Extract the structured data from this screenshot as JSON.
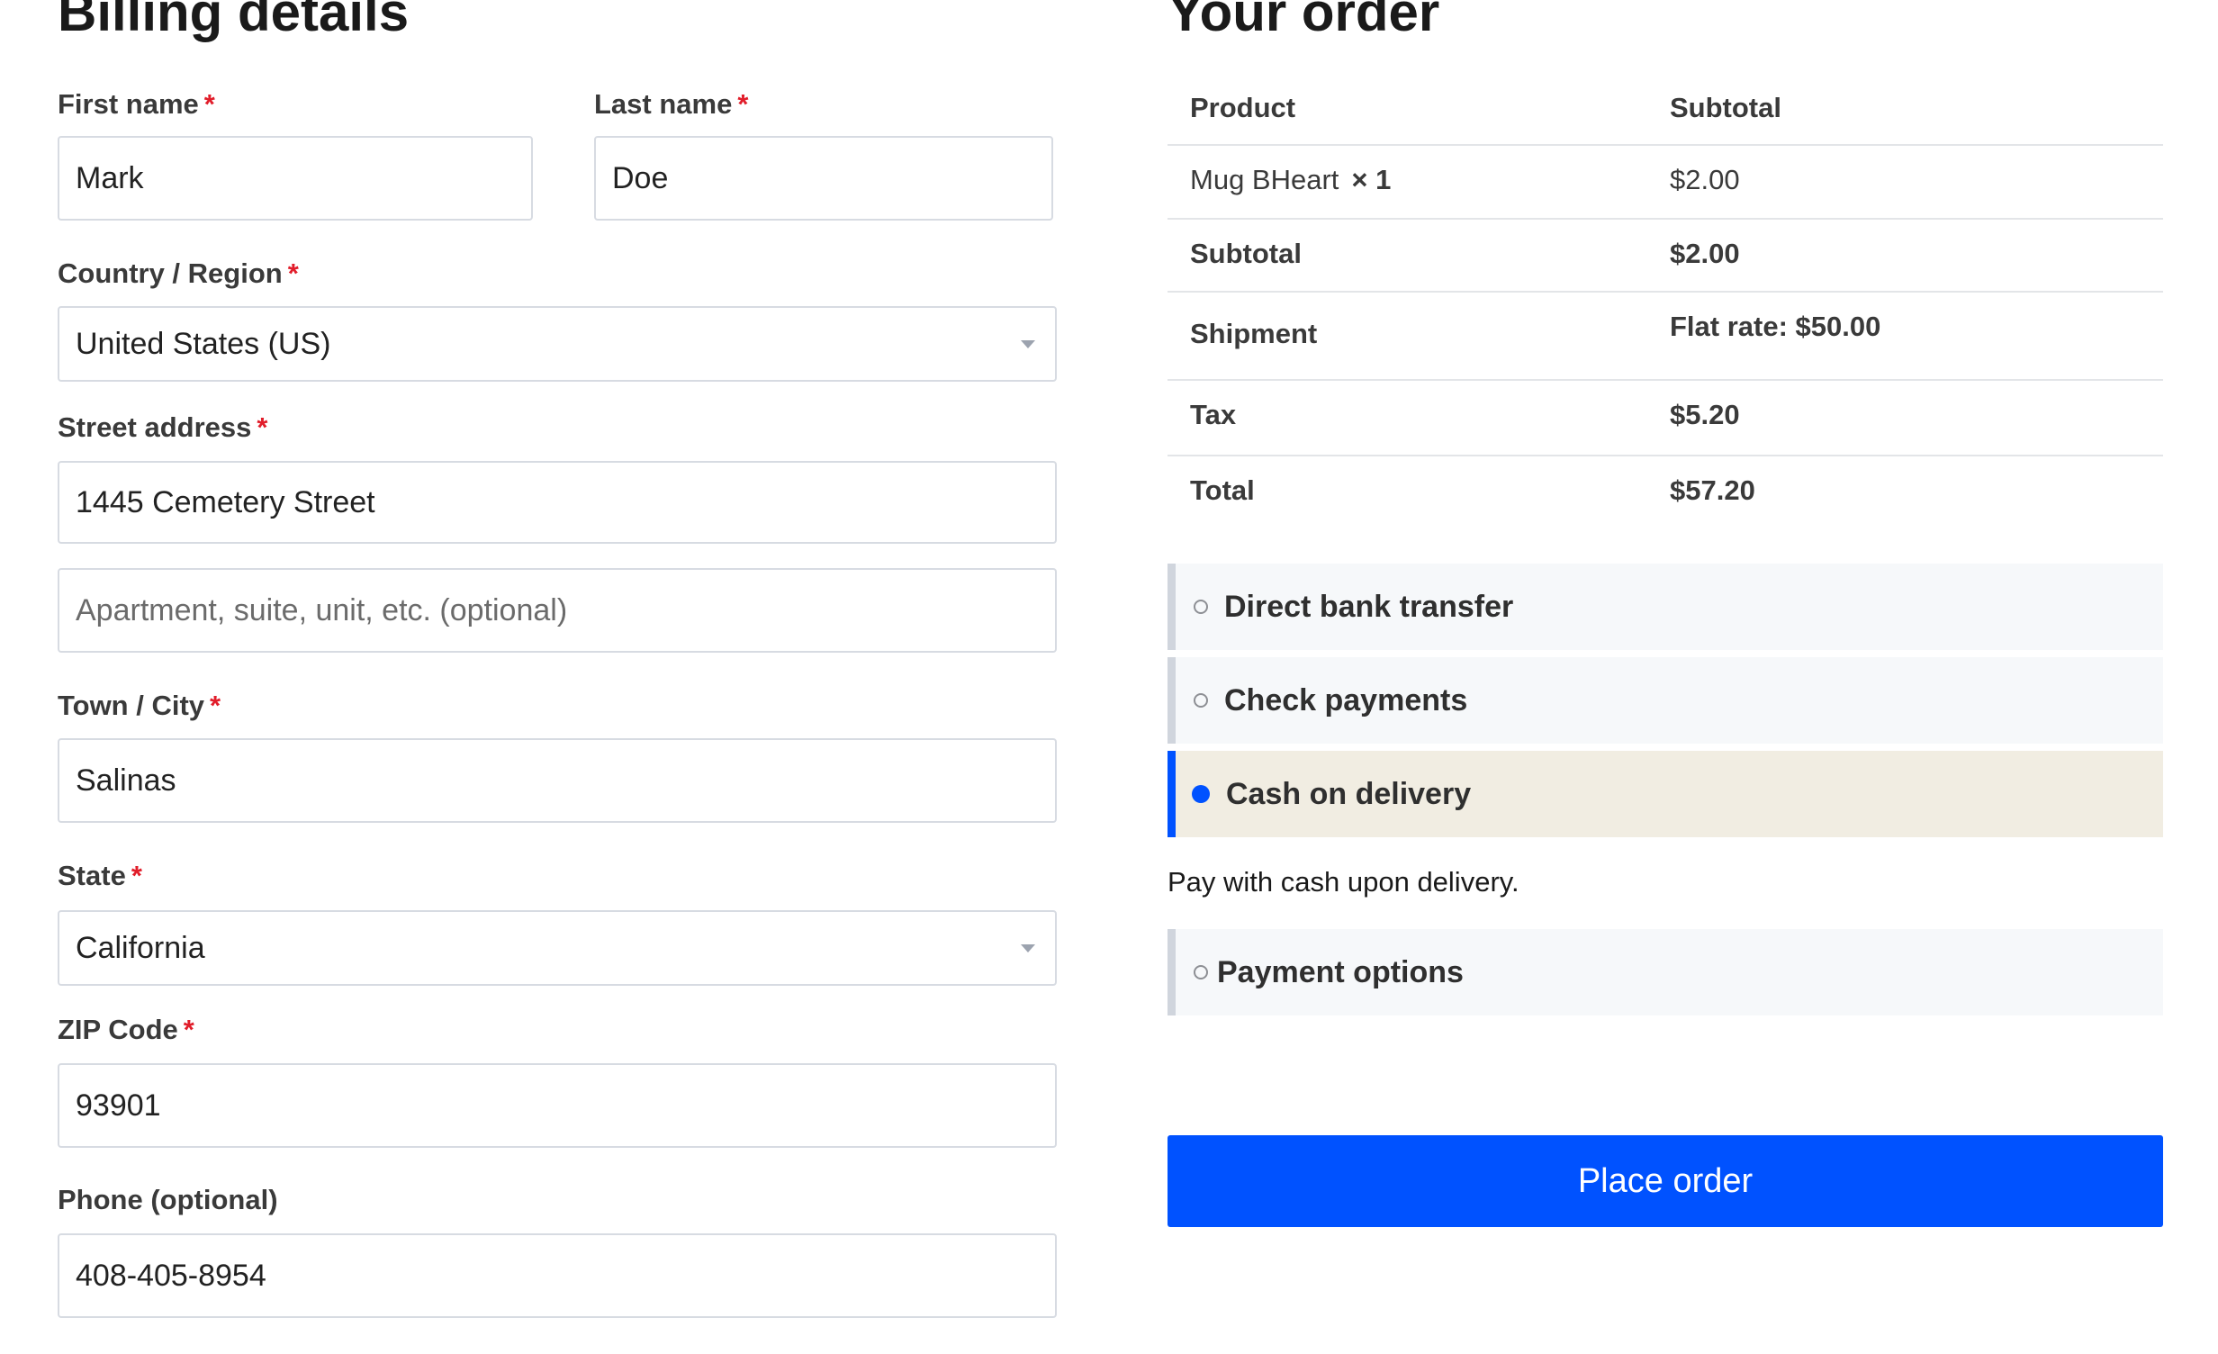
{
  "billing": {
    "title": "Billing details",
    "required_marker": "*",
    "first_name": {
      "label": "First name",
      "value": "Mark"
    },
    "last_name": {
      "label": "Last name",
      "value": "Doe"
    },
    "country": {
      "label": "Country / Region",
      "value": "United States (US)"
    },
    "street": {
      "label": "Street address",
      "value": "1445 Cemetery Street",
      "apt_placeholder": "Apartment, suite, unit, etc. (optional)"
    },
    "city": {
      "label": "Town / City",
      "value": "Salinas"
    },
    "state": {
      "label": "State",
      "value": "California"
    },
    "zip": {
      "label": "ZIP Code",
      "value": "93901"
    },
    "phone": {
      "label": "Phone (optional)",
      "value": "408-405-8954"
    }
  },
  "order": {
    "title": "Your order",
    "headers": {
      "product": "Product",
      "subtotal": "Subtotal"
    },
    "item": {
      "name": "Mug BHeart",
      "qty": "× 1",
      "price": "$2.00"
    },
    "subtotal": {
      "label": "Subtotal",
      "value": "$2.00"
    },
    "shipment": {
      "label": "Shipment",
      "value": "Flat rate: $50.00"
    },
    "tax": {
      "label": "Tax",
      "value": "$5.20"
    },
    "total": {
      "label": "Total",
      "value": "$57.20"
    },
    "payment_methods": [
      {
        "label": "Direct bank transfer",
        "selected": false
      },
      {
        "label": "Check payments",
        "selected": false
      },
      {
        "label": "Cash on delivery",
        "selected": true
      },
      {
        "label": "Payment options",
        "selected": false
      }
    ],
    "selected_description": "Pay with cash upon delivery.",
    "place_order_label": "Place order"
  },
  "colors": {
    "accent": "#0052ff",
    "required": "#e11d2a",
    "selected_bg": "#f1ede2",
    "method_bg": "#f6f8fa"
  }
}
